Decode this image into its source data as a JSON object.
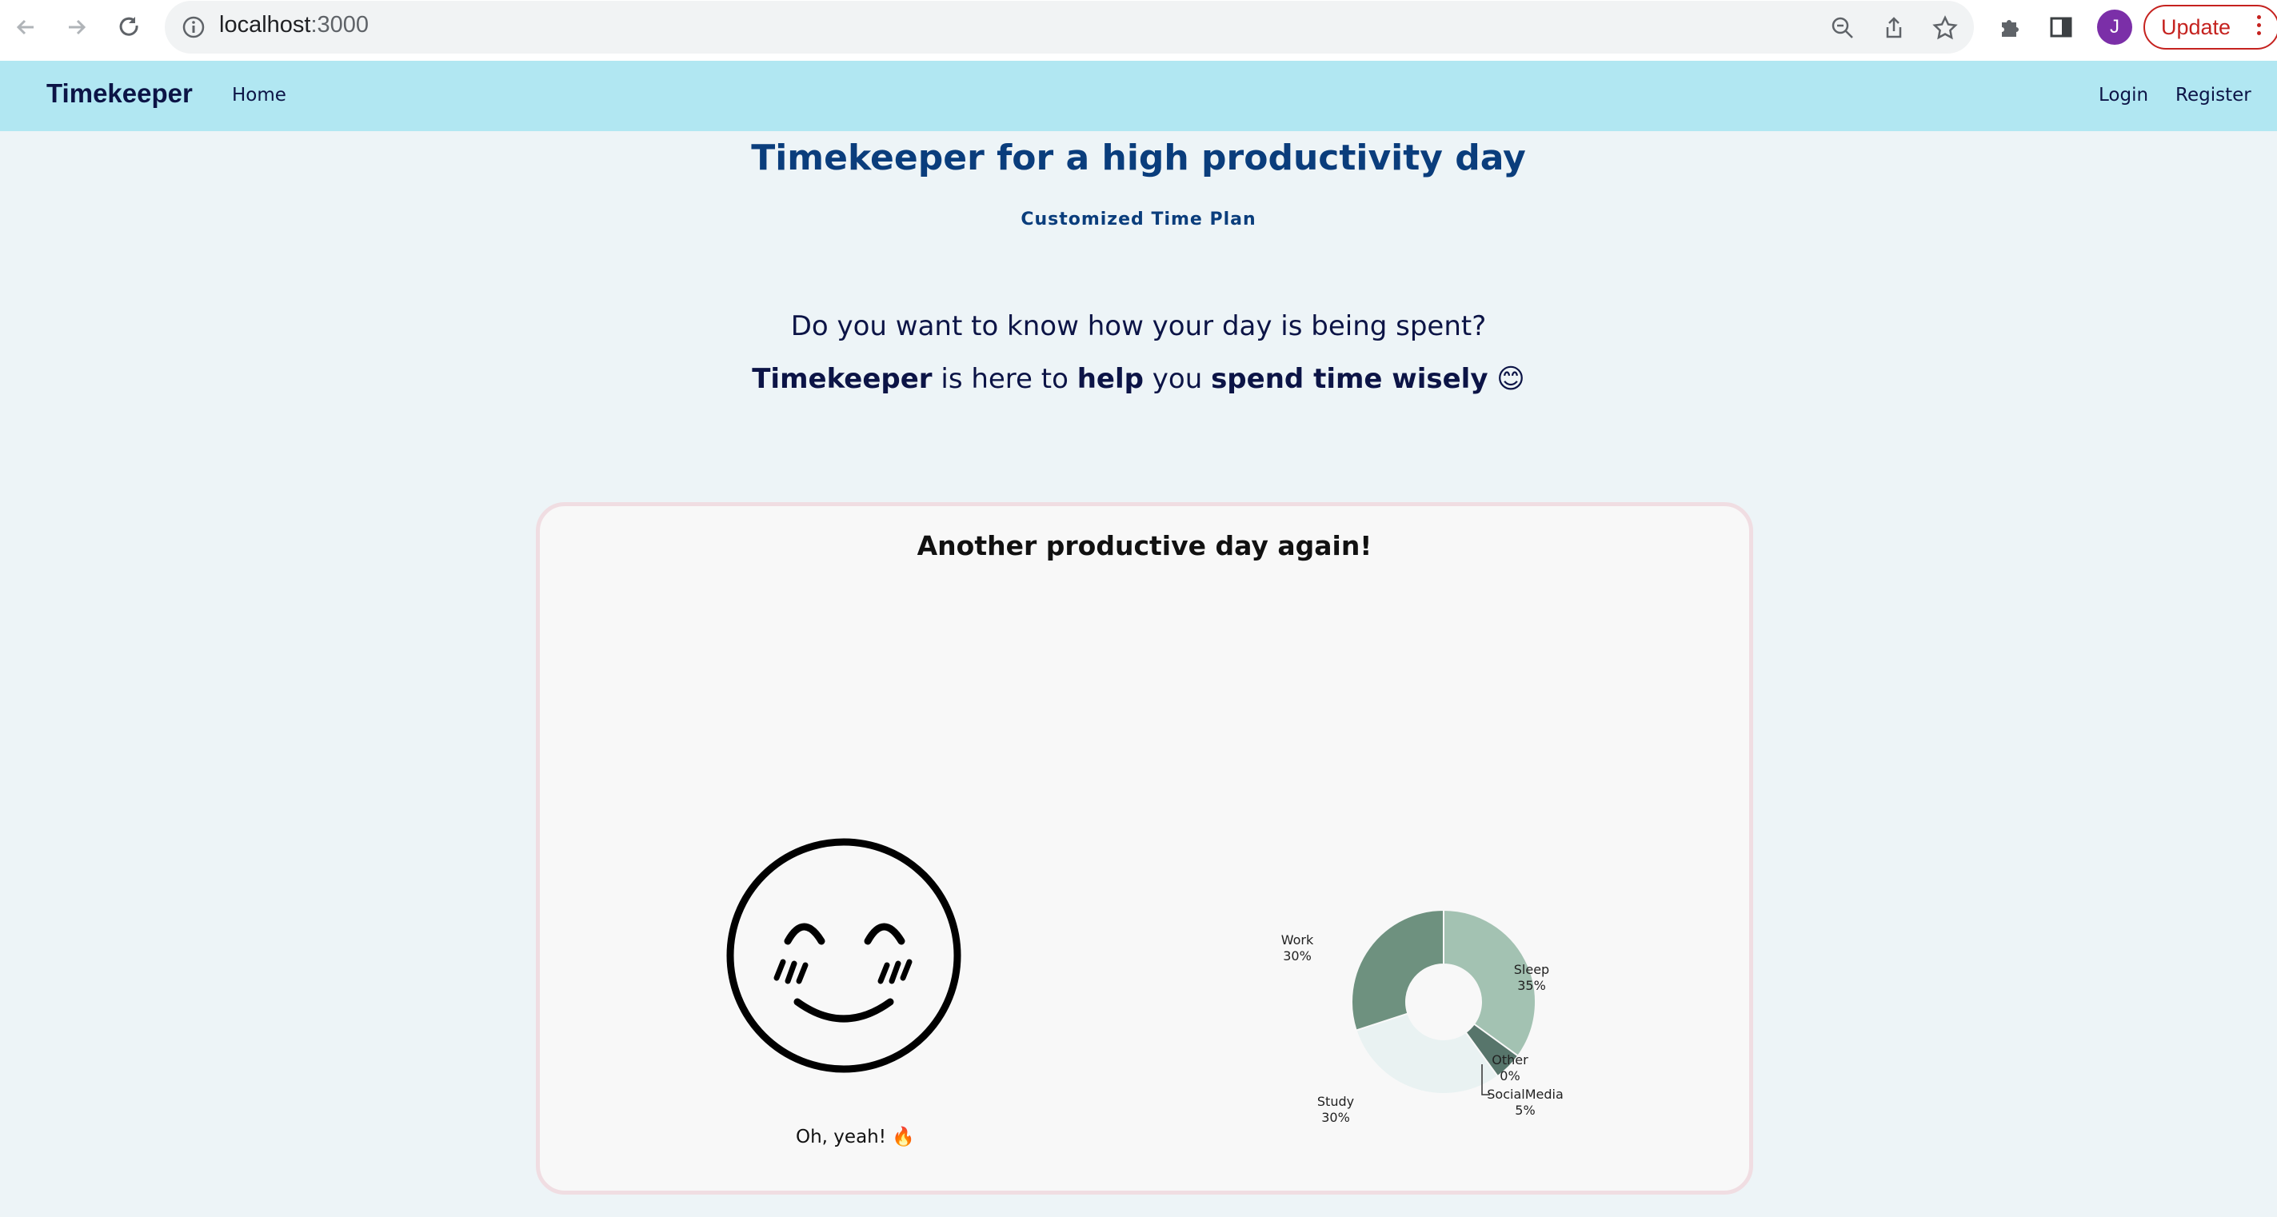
{
  "browser": {
    "url_host": "localhost",
    "url_port": ":3000",
    "profile_initial": "J",
    "update_label": "Update"
  },
  "navbar": {
    "brand": "Timekeeper",
    "home": "Home",
    "login": "Login",
    "register": "Register",
    "background": "#b1e7f2"
  },
  "hero": {
    "title": "Timekeeper for a high productivity day",
    "subtitle": "Customized Time Plan",
    "question": "Do you want to know how your day is being spent?",
    "line_brand": "Timekeeper",
    "line_t1": " is here to ",
    "line_help": "help",
    "line_t2": " you ",
    "line_wise": "spend time wisely",
    "line_emoji": " 😊"
  },
  "card": {
    "title": "Another productive day again!",
    "caption": "Oh, yeah! 🔥"
  },
  "chart_data": {
    "type": "pie",
    "hole": true,
    "slices": [
      {
        "name": "Sleep",
        "label": "35%",
        "value": 35,
        "color": "#a3c2b2"
      },
      {
        "name": "SocialMedia",
        "label": "5%",
        "value": 5,
        "color": "#57756b"
      },
      {
        "name": "Other",
        "label": "0%",
        "value": 0,
        "color": "#57756b"
      },
      {
        "name": "Study",
        "label": "30%",
        "value": 30,
        "color": "#e9f2f2"
      },
      {
        "name": "Work",
        "label": "30%",
        "value": 30,
        "color": "#6e917f"
      }
    ]
  }
}
